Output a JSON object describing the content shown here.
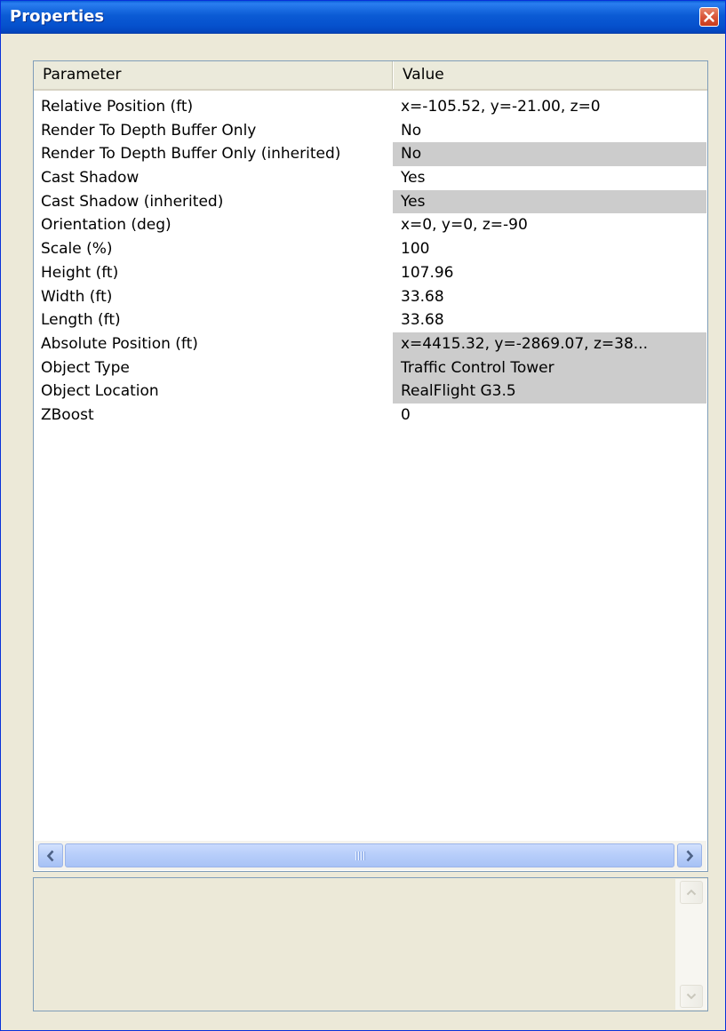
{
  "window": {
    "title": "Properties"
  },
  "table": {
    "columns": [
      "Parameter",
      "Value"
    ],
    "rows": [
      {
        "parameter": "Relative Position (ft)",
        "value": "x=-105.52, y=-21.00, z=0",
        "readonly": false
      },
      {
        "parameter": "Render To Depth Buffer Only",
        "value": "No",
        "readonly": false
      },
      {
        "parameter": "Render To Depth Buffer Only (inherited)",
        "value": "No",
        "readonly": true
      },
      {
        "parameter": "Cast Shadow",
        "value": "Yes",
        "readonly": false
      },
      {
        "parameter": "Cast Shadow (inherited)",
        "value": "Yes",
        "readonly": true
      },
      {
        "parameter": "Orientation (deg)",
        "value": "x=0, y=0, z=-90",
        "readonly": false
      },
      {
        "parameter": "Scale (%)",
        "value": "100",
        "readonly": false
      },
      {
        "parameter": "Height (ft)",
        "value": "107.96",
        "readonly": false
      },
      {
        "parameter": "Width (ft)",
        "value": "33.68",
        "readonly": false
      },
      {
        "parameter": "Length (ft)",
        "value": "33.68",
        "readonly": false
      },
      {
        "parameter": "Absolute Position (ft)",
        "value": "x=4415.32, y=-2869.07, z=38...",
        "readonly": true
      },
      {
        "parameter": "Object Type",
        "value": "Traffic Control Tower",
        "readonly": true
      },
      {
        "parameter": "Object Location",
        "value": "RealFlight  G3.5",
        "readonly": true
      },
      {
        "parameter": "ZBoost",
        "value": "0",
        "readonly": false
      }
    ]
  },
  "description": {
    "text": ""
  },
  "icons": {
    "close": "close-icon",
    "scroll_left": "arrow-left-icon",
    "scroll_right": "arrow-right-icon",
    "scroll_up": "arrow-up-icon",
    "scroll_down": "arrow-down-icon"
  },
  "colors": {
    "title_bar": "#0550cc",
    "readonly_cell": "#cccccc",
    "close_button": "#d9563a"
  }
}
